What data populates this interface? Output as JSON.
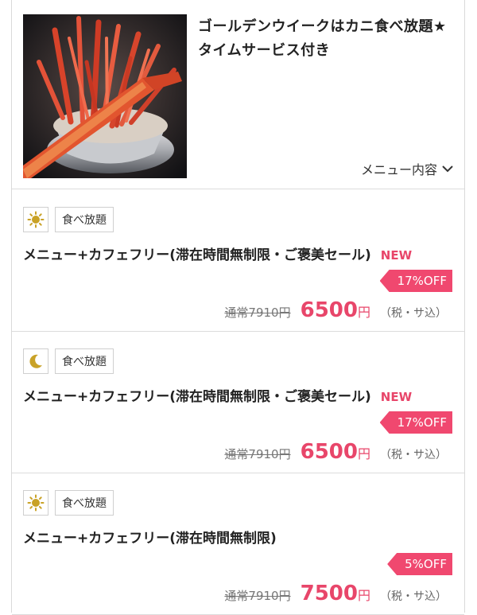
{
  "header": {
    "title": "ゴールデンウイークはカニ食べ放題★タイムサービス付き",
    "menu_toggle": "メニュー内容"
  },
  "plans": [
    {
      "time_icon": "sun-icon",
      "category": "食べ放題",
      "name": "メニュー+カフェフリー(滞在時間無制限・ご褒美セール)",
      "badge": "NEW",
      "discount": "17%OFF",
      "regular": "通常7910円",
      "price": "6500",
      "yen": "円",
      "tax": "（税・サ込）"
    },
    {
      "time_icon": "moon-icon",
      "category": "食べ放題",
      "name": "メニュー+カフェフリー(滞在時間無制限・ご褒美セール)",
      "badge": "NEW",
      "discount": "17%OFF",
      "regular": "通常7910円",
      "price": "6500",
      "yen": "円",
      "tax": "（税・サ込）"
    },
    {
      "time_icon": "sun-icon",
      "category": "食べ放題",
      "name": "メニュー+カフェフリー(滞在時間無制限)",
      "badge": "",
      "discount": "5%OFF",
      "regular": "通常7910円",
      "price": "7500",
      "yen": "円",
      "tax": "（税・サ込）"
    }
  ],
  "colors": {
    "accent": "#e8466a",
    "discount_bg": "#f0486f",
    "icon_gold": "#c9a227"
  }
}
